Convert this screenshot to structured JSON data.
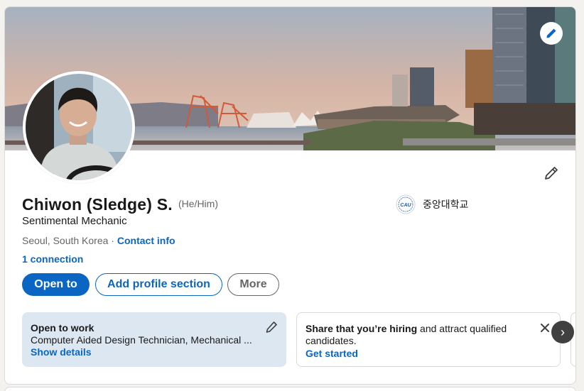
{
  "profile": {
    "name": "Chiwon (Sledge) S.",
    "pronouns": "(He/Him)",
    "headline": "Sentimental Mechanic",
    "location": "Seoul, South Korea",
    "separator": " · ",
    "contact_info": "Contact info",
    "connections": "1 connection",
    "school": "중앙대학교",
    "school_logo_text": "CAU"
  },
  "actions": {
    "open_to": "Open to",
    "add_section": "Add profile section",
    "more": "More"
  },
  "open_to_work": {
    "title": "Open to work",
    "description": "Computer Aided Design Technician, Mechanical ...",
    "link": "Show details"
  },
  "hiring": {
    "bold": "Share that you’re hiring",
    "rest": " and attract qualified candidates.",
    "link": "Get started"
  },
  "icons": {
    "banner_edit": "pencil-icon",
    "profile_edit": "pencil-icon",
    "otw_edit": "pencil-icon",
    "close": "close-icon",
    "carousel_next": "chevron-right-icon",
    "carousel_next_glyph": "›"
  },
  "colors": {
    "accent": "#0a66c2",
    "open_to_work_bg": "#dde7f1",
    "page_bg": "#f4f2ee"
  }
}
